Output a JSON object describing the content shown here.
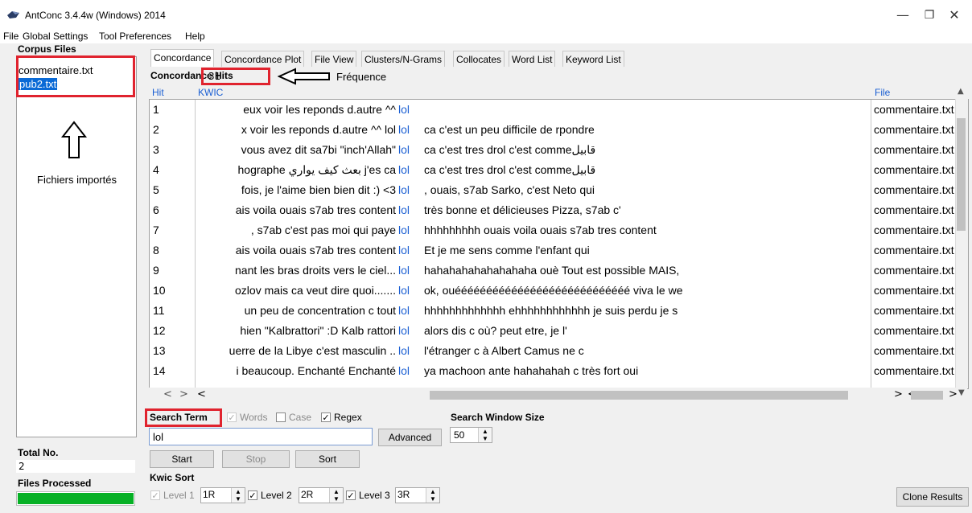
{
  "window": {
    "title": "AntConc 3.4.4w (Windows) 2014",
    "minimize": "—",
    "maximize": "❐",
    "close": "✕"
  },
  "menu": [
    "File",
    "Global Settings",
    "Tool Preferences",
    "Help"
  ],
  "corpus": {
    "label": "Corpus Files",
    "files": [
      "commentaire.txt",
      "pub2.txt"
    ],
    "annotation": "Fichiers importés"
  },
  "total": {
    "label": "Total No.",
    "value": "2"
  },
  "processed": {
    "label": "Files Processed",
    "progress": 1.0
  },
  "tabs": [
    "Concordance",
    "Concordance Plot",
    "File View",
    "Clusters/N-Grams",
    "Collocates",
    "Word List",
    "Keyword List"
  ],
  "hits": {
    "label": "Concordance Hits",
    "value": "31",
    "annotation": "Fréquence"
  },
  "columns": {
    "hit": "Hit",
    "kwic": "KWIC",
    "file": "File"
  },
  "rows": [
    {
      "n": "1",
      "left": "eux voir les reponds d.autre ^^",
      "key": "lol",
      "right": "",
      "file": "commentaire.txt"
    },
    {
      "n": "2",
      "left": "x voir les reponds d.autre ^^ lol",
      "key": "lol",
      "right": "ca c'est un peu difficile de rpondre",
      "file": "commentaire.txt"
    },
    {
      "n": "3",
      "left": "vous avez dit sa7bi \"inch'Allah\"",
      "key": "lol",
      "right": "ca c'est tres drol c'est commeقابيل",
      "file": "commentaire.txt"
    },
    {
      "n": "4",
      "left": "hographe بعث كيف يواري j'es ca",
      "key": "lol",
      "right": "ca c'est tres drol c'est commeقابيل",
      "file": "commentaire.txt"
    },
    {
      "n": "5",
      "left": "fois, je l'aime bien bien dit :) <3",
      "key": "lol",
      "right": ", ouais, s7ab Sarko, c'est Neto qui",
      "file": "commentaire.txt"
    },
    {
      "n": "6",
      "left": "ais voila ouais s7ab tres content",
      "key": "lol",
      "right": "très bonne et délicieuses Pizza, s7ab c'",
      "file": "commentaire.txt"
    },
    {
      "n": "7",
      "left": ", s7ab c'est pas moi qui paye",
      "key": "lol",
      "right": "hhhhhhhhh ouais voila ouais s7ab tres content",
      "file": "commentaire.txt"
    },
    {
      "n": "8",
      "left": "ais voila ouais s7ab tres content",
      "key": "lol",
      "right": "Et je me sens comme l'enfant qui",
      "file": "commentaire.txt"
    },
    {
      "n": "9",
      "left": "nant les bras droits vers le ciel...",
      "key": "lol",
      "right": "hahahahahahahahaha ouè Tout est possible MAIS,",
      "file": "commentaire.txt"
    },
    {
      "n": "10",
      "left": "ozlov mais ca veut dire quoi.......",
      "key": "lol",
      "right": "ok, ouéééééééééééééééééééééééééééé viva le we",
      "file": "commentaire.txt"
    },
    {
      "n": "11",
      "left": "un peu de concentration c tout",
      "key": "lol",
      "right": "hhhhhhhhhhhhh ehhhhhhhhhhhh je suis perdu je s",
      "file": "commentaire.txt"
    },
    {
      "n": "12",
      "left": "hien \"Kalbrattori\" :D Kalb rattori",
      "key": "lol",
      "right": "alors dis c où? peut etre, je l'",
      "file": "commentaire.txt"
    },
    {
      "n": "13",
      "left": "uerre de la Libye c'est masculin ..",
      "key": "lol",
      "right": "l'étranger c à Albert Camus ne c",
      "file": "commentaire.txt"
    },
    {
      "n": "14",
      "left": "i beaucoup. Enchanté Enchanté",
      "key": "lol",
      "right": "ya machoon ante hahahahah c très fort oui",
      "file": "commentaire.txt"
    }
  ],
  "search": {
    "label": "Search Term",
    "words": "Words",
    "case": "Case",
    "regex": "Regex",
    "value": "lol",
    "advanced": "Advanced",
    "window_label": "Search Window Size",
    "window_value": "50",
    "start": "Start",
    "stop": "Stop",
    "sort": "Sort"
  },
  "kwic_sort": {
    "label": "Kwic Sort",
    "levels": [
      {
        "label": "Level 1",
        "value": "1R"
      },
      {
        "label": "Level 2",
        "value": "2R"
      },
      {
        "label": "Level 3",
        "value": "3R"
      }
    ]
  },
  "clone": "Clone Results",
  "colors": {
    "highlight_red": "#e0232e",
    "kwic_blue": "#1b5fd3",
    "progress_green": "#06b025",
    "selection_blue": "#0a6ad6"
  }
}
